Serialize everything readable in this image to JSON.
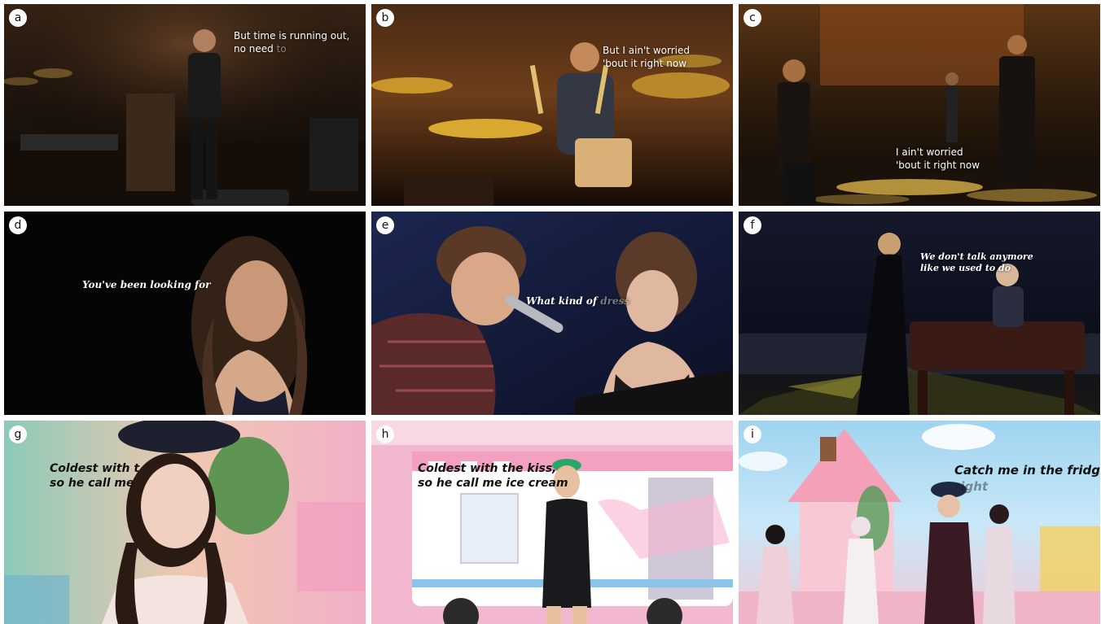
{
  "panels": [
    {
      "id": "a",
      "lines": [
        "But time is running out,",
        "no need"
      ],
      "dim_word": "to"
    },
    {
      "id": "b",
      "lines": [
        "But I ain't worried",
        "'bout it right now"
      ],
      "dim_word": ""
    },
    {
      "id": "c",
      "lines": [
        "I ain't worried",
        "'bout it right now"
      ],
      "dim_word": ""
    },
    {
      "id": "d",
      "lines": [
        "You've been looking for"
      ],
      "dim_word": ""
    },
    {
      "id": "e",
      "lines": [
        "What kind of"
      ],
      "dim_word": "dress"
    },
    {
      "id": "f",
      "lines": [
        "We don't talk anymore",
        "like we used to do"
      ],
      "dim_word": ""
    },
    {
      "id": "g",
      "lines": [
        "Coldest with t",
        "so he call me"
      ],
      "dim_word": ""
    },
    {
      "id": "h",
      "lines": [
        "Coldest with the kiss,",
        "so he call me ice cream"
      ],
      "dim_word": ""
    },
    {
      "id": "i",
      "lines": [
        "Catch me in the fridge,"
      ],
      "dim_word": "right"
    }
  ],
  "colors": {
    "concert_dark": "#1a120c",
    "stage_warm": "#c88a2a",
    "night_navy": "#141a33",
    "pastel_pink": "#f2b8cf",
    "sky_blue": "#9fd3f0"
  }
}
